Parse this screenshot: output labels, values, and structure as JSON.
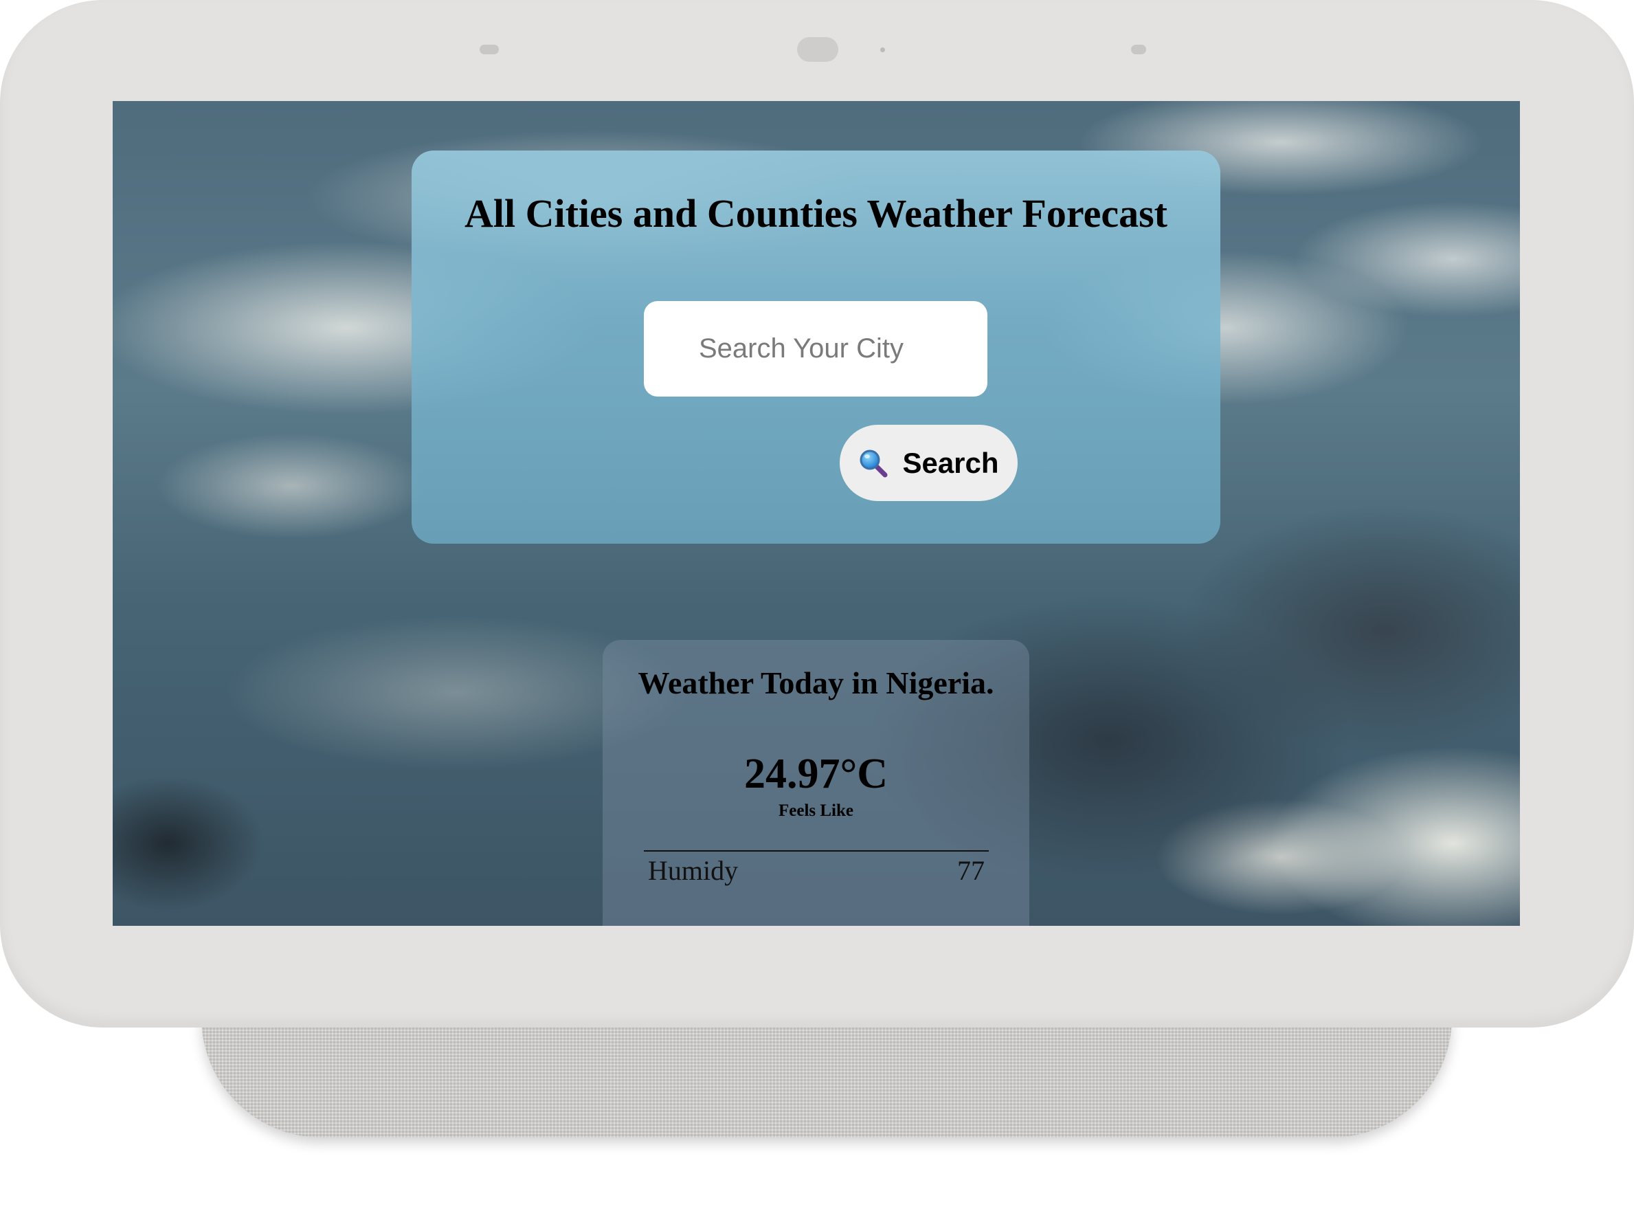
{
  "app": {
    "title": "All Cities and Counties Weather Forecast"
  },
  "search": {
    "placeholder": "Search Your City",
    "value": "",
    "button_label": "Search",
    "button_icon": "magnifier-icon"
  },
  "weather": {
    "heading": "Weather Today in Nigeria.",
    "temperature": "24.97°C",
    "feels_like_label": "Feels Like",
    "metrics": [
      {
        "label": "Humidy",
        "value": "77"
      }
    ]
  },
  "colors": {
    "search_card": "#8cc3d9",
    "button_bg": "#eeeeee",
    "device_frame": "#e3e2e0"
  }
}
